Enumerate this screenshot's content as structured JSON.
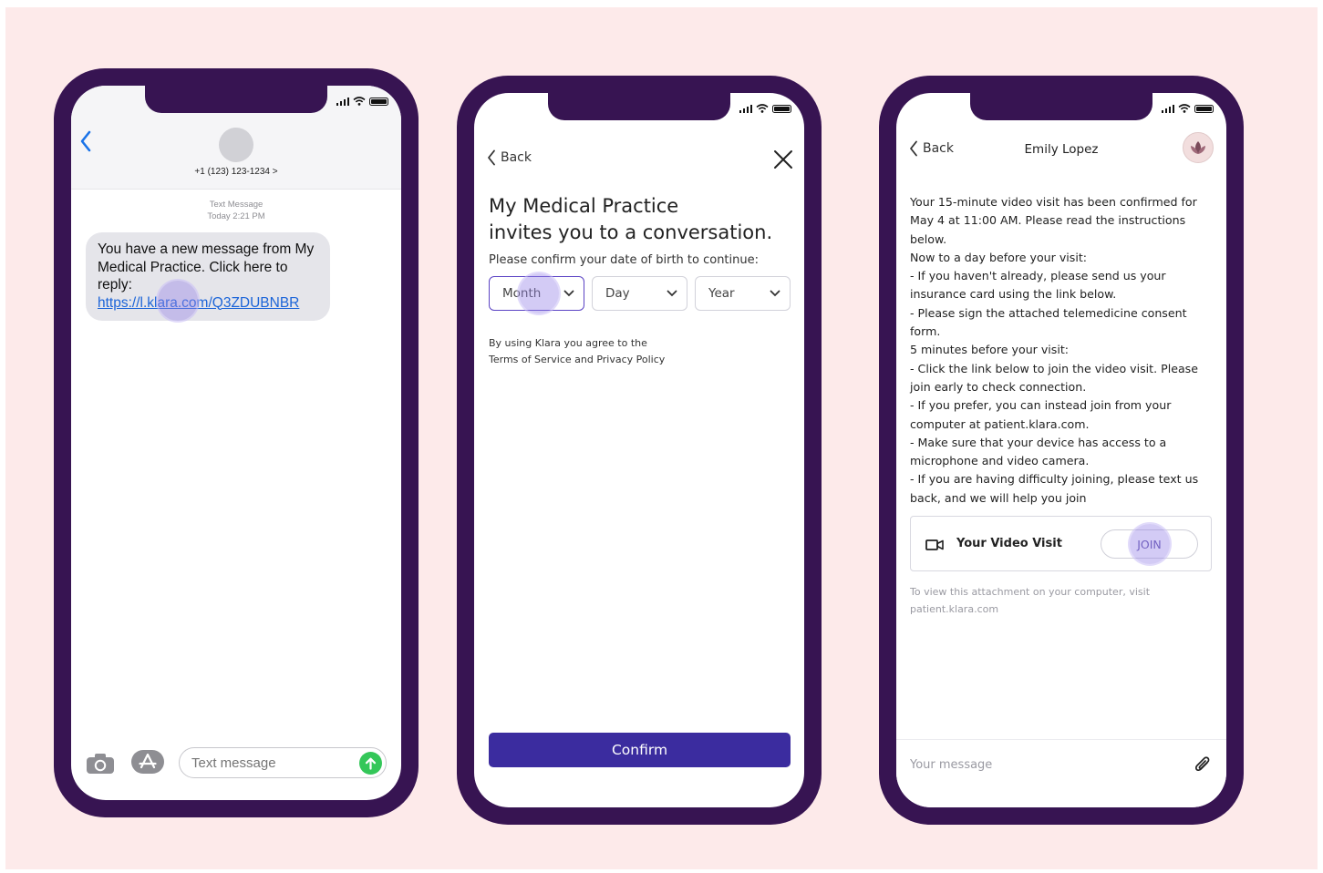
{
  "colors": {
    "phone_frame": "#371452",
    "page_bg": "#fdeaea",
    "accent": "#3b2c9f",
    "imessage_link": "#1b64d8",
    "send_green": "#34c759"
  },
  "phone1": {
    "contact_number": "+1 (123) 123-1234 >",
    "meta_type": "Text Message",
    "meta_time": "Today 2:21 PM",
    "message_line1": "You have a new message from My Medical Practice. Click here to reply:",
    "message_link": "https://l.klara.com/Q3ZDUBNBR",
    "input_placeholder": "Text message",
    "icons": [
      "back-chevron-icon",
      "camera-icon",
      "app-store-icon",
      "send-arrow-icon"
    ]
  },
  "phone2": {
    "back_label": "Back",
    "title_line1": "My Medical Practice",
    "title_line2": "invites you to a conversation.",
    "prompt": "Please confirm your date of birth to continue:",
    "month_label": "Month",
    "day_label": "Day",
    "year_label": "Year",
    "terms_line1": "By using Klara you agree to the",
    "terms_line2": "Terms of Service and Privacy Policy",
    "confirm_label": "Confirm"
  },
  "phone3": {
    "back_label": "Back",
    "contact_name": "Emily Lopez",
    "message_lines": [
      "Your 15-minute video visit has been confirmed for May 4 at 11:00 AM. Please read the instructions below.",
      "Now to a day before your visit:",
      "- If you haven't already, please send us your insurance card using the link below.",
      "- Please sign the attached telemedicine consent form.",
      "5 minutes before your visit:",
      "- Click the link below to join the video visit. Please join early to check connection.",
      "- If you prefer, you can instead join from your computer at patient.klara.com.",
      "- Make sure that your device has access to a microphone and video camera.",
      "- If you are having difficulty joining, please text us back, and we will help you join"
    ],
    "card_title": "Your Video Visit",
    "join_label": "JOIN",
    "note": "To view this attachment on your computer, visit patient.klara.com",
    "input_placeholder": "Your message"
  }
}
